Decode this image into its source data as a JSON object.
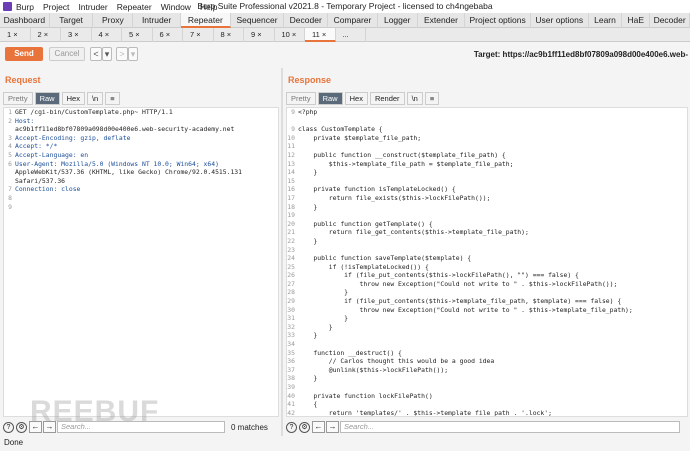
{
  "window": {
    "menu": [
      "Burp",
      "Project",
      "Intruder",
      "Repeater",
      "Window",
      "Help"
    ],
    "title": "Burp Suite Professional v2021.8 - Temporary Project - licensed to ch4ngebaba"
  },
  "top_tabs": [
    {
      "label": "Dashboard",
      "w": 50
    },
    {
      "label": "Target",
      "w": 44
    },
    {
      "label": "Proxy",
      "w": 40
    },
    {
      "label": "Intruder",
      "w": 48
    },
    {
      "label": "Repeater",
      "w": 50,
      "active": true
    },
    {
      "label": "Sequencer",
      "w": 54
    },
    {
      "label": "Decoder",
      "w": 44
    },
    {
      "label": "Comparer",
      "w": 50
    },
    {
      "label": "Logger",
      "w": 40
    },
    {
      "label": "Extender",
      "w": 48
    },
    {
      "label": "Project options",
      "w": 66
    },
    {
      "label": "User options",
      "w": 58
    },
    {
      "label": "Learn",
      "w": 34
    },
    {
      "label": "HaE",
      "w": 28
    },
    {
      "label": "Decoder",
      "w": 40
    }
  ],
  "sub_tabs": [
    "1 ×",
    "2 ×",
    "3 ×",
    "4 ×",
    "5 ×",
    "6 ×",
    "7 ×",
    "8 ×",
    "9 ×",
    "10 ×",
    "11 ×",
    "..."
  ],
  "toolbar": {
    "send": "Send",
    "cancel": "Cancel",
    "back": "<",
    "back_dd": "▾",
    "fwd": ">",
    "fwd_dd": "▾",
    "target": "Target: https://ac9b1ff11ed8bf07809a098d00e400e6.web-"
  },
  "request": {
    "heading": "Request",
    "views": [
      "Pretty",
      "Raw",
      "Hex",
      "\\n",
      "≡"
    ],
    "lines": [
      {
        "n": "1",
        "t": "GET /cgi-bin/CustomTemplate.php~ HTTP/1.1"
      },
      {
        "n": "2",
        "t": "Host:",
        "h": true
      },
      {
        "n": "",
        "t": "ac9b1ff11ed8bf07809a098d00e400e6.web-security-academy.net"
      },
      {
        "n": "3",
        "t": "Accept-Encoding: gzip, deflate",
        "h": true
      },
      {
        "n": "4",
        "t": "Accept: */*",
        "h": true
      },
      {
        "n": "5",
        "t": "Accept-Language: en",
        "h": true
      },
      {
        "n": "6",
        "t": "User-Agent: Mozilla/5.0 (Windows NT 10.0; Win64; x64)",
        "h": true
      },
      {
        "n": "",
        "t": "AppleWebKit/537.36 (KHTML, like Gecko) Chrome/92.0.4515.131"
      },
      {
        "n": "",
        "t": "Safari/537.36"
      },
      {
        "n": "7",
        "t": "Connection: close",
        "h": true
      },
      {
        "n": "8",
        "t": ""
      },
      {
        "n": "9",
        "t": ""
      }
    ],
    "search_placeholder": "Search...",
    "matches": "0 matches"
  },
  "response": {
    "heading": "Response",
    "views": [
      "Pretty",
      "Raw",
      "Hex",
      "Render",
      "\\n",
      "≡"
    ],
    "lines": [
      {
        "n": "9",
        "t": "<?php"
      },
      {
        "n": "",
        "t": ""
      },
      {
        "n": "9",
        "t": "class CustomTemplate {"
      },
      {
        "n": "10",
        "t": "    private $template_file_path;"
      },
      {
        "n": "11",
        "t": ""
      },
      {
        "n": "12",
        "t": "    public function __construct($template_file_path) {"
      },
      {
        "n": "13",
        "t": "        $this->template_file_path = $template_file_path;"
      },
      {
        "n": "14",
        "t": "    }"
      },
      {
        "n": "15",
        "t": ""
      },
      {
        "n": "16",
        "t": "    private function isTemplateLocked() {"
      },
      {
        "n": "17",
        "t": "        return file_exists($this->lockFilePath());"
      },
      {
        "n": "18",
        "t": "    }"
      },
      {
        "n": "19",
        "t": ""
      },
      {
        "n": "20",
        "t": "    public function getTemplate() {"
      },
      {
        "n": "21",
        "t": "        return file_get_contents($this->template_file_path);"
      },
      {
        "n": "22",
        "t": "    }"
      },
      {
        "n": "23",
        "t": ""
      },
      {
        "n": "24",
        "t": "    public function saveTemplate($template) {"
      },
      {
        "n": "25",
        "t": "        if (!isTemplateLocked()) {"
      },
      {
        "n": "26",
        "t": "            if (file_put_contents($this->lockFilePath(), \"\") === false) {"
      },
      {
        "n": "27",
        "t": "                throw new Exception(\"Could not write to \" . $this->lockFilePath());"
      },
      {
        "n": "28",
        "t": "            }"
      },
      {
        "n": "29",
        "t": "            if (file_put_contents($this->template_file_path, $template) === false) {"
      },
      {
        "n": "30",
        "t": "                throw new Exception(\"Could not write to \" . $this->template_file_path);"
      },
      {
        "n": "31",
        "t": "            }"
      },
      {
        "n": "32",
        "t": "        }"
      },
      {
        "n": "33",
        "t": "    }"
      },
      {
        "n": "34",
        "t": ""
      },
      {
        "n": "35",
        "t": "    function __destruct() {"
      },
      {
        "n": "36",
        "t": "        // Carlos thought this would be a good idea"
      },
      {
        "n": "37",
        "t": "        @unlink($this->lockFilePath());"
      },
      {
        "n": "38",
        "t": "    }"
      },
      {
        "n": "39",
        "t": ""
      },
      {
        "n": "40",
        "t": "    private function lockFilePath()"
      },
      {
        "n": "41",
        "t": "    {"
      },
      {
        "n": "42",
        "t": "        return 'templates/' . $this->template_file_path . '.lock';"
      },
      {
        "n": "43",
        "t": "    }"
      },
      {
        "n": "44",
        "t": "}"
      }
    ],
    "search_placeholder": "Search..."
  },
  "status": "Done",
  "watermark": "REEBUF"
}
